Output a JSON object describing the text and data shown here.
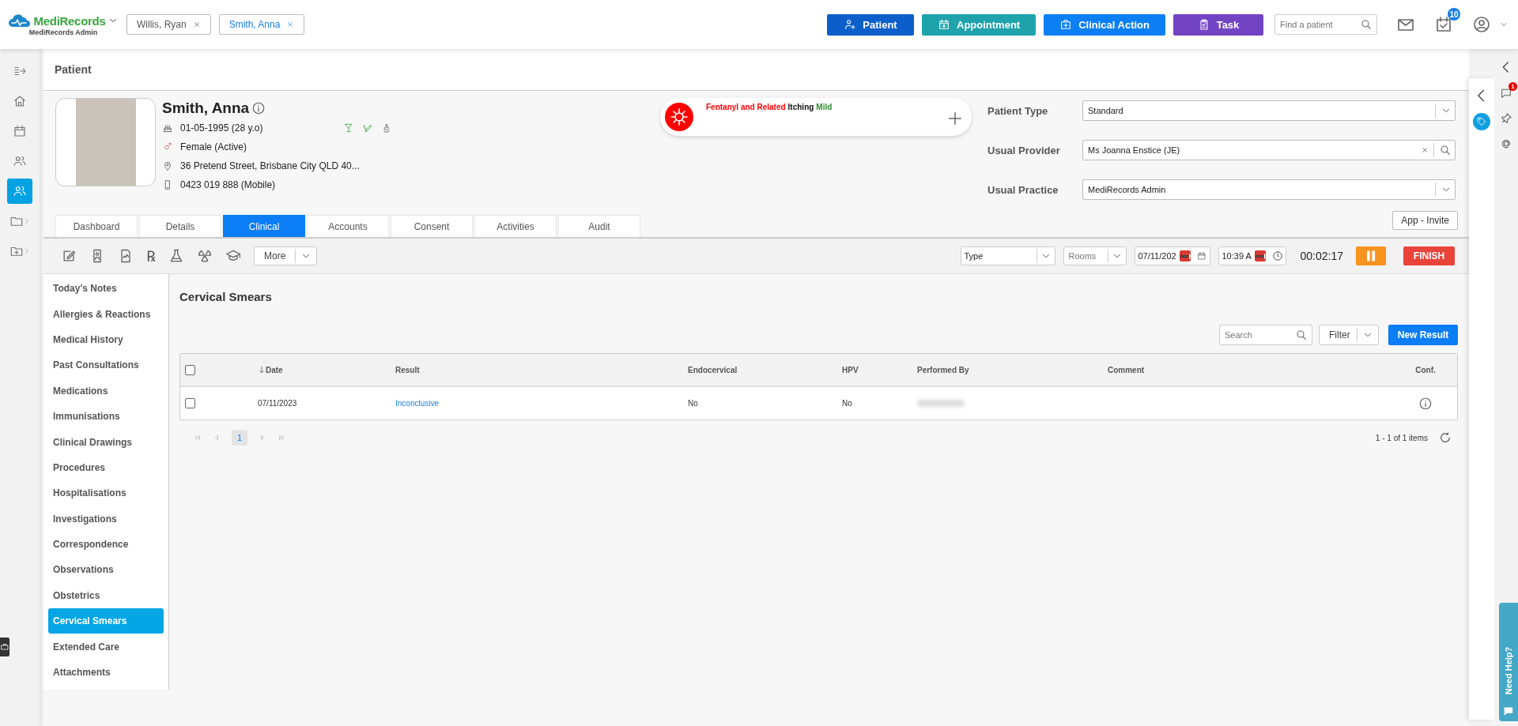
{
  "app": {
    "brand": "MediRecords",
    "subtitle": "MediRecords Admin"
  },
  "patient_tabs": [
    {
      "label": "Willis, Ryan",
      "selected": false
    },
    {
      "label": "Smith, Anna",
      "selected": true
    }
  ],
  "actions": [
    {
      "label": "Patient",
      "kind": "patient"
    },
    {
      "label": "Appointment",
      "kind": "appointment"
    },
    {
      "label": "Clinical Action",
      "kind": "clinical"
    },
    {
      "label": "Task",
      "kind": "task"
    }
  ],
  "find_patient": {
    "placeholder": "Find a patient"
  },
  "tasks_badge": "10",
  "rail": [
    {
      "kind": "collapse",
      "selected": false
    },
    {
      "kind": "home",
      "selected": false
    },
    {
      "kind": "calendar",
      "selected": false
    },
    {
      "kind": "group",
      "selected": false
    },
    {
      "kind": "patients",
      "selected": true
    },
    {
      "kind": "folder",
      "selected": false
    },
    {
      "kind": "folder-plus",
      "selected": false
    }
  ],
  "page_title": "Patient",
  "patient": {
    "name": "Smith, Anna",
    "dob": "01-05-1995 (28 y.o)",
    "gender": "Female (Active)",
    "address": "36 Pretend Street, Brisbane City QLD 40...",
    "phone": "0423 019 888 (Mobile)"
  },
  "allergy": {
    "substance": "Fentanyl and Related",
    "reaction": "Itching",
    "severity": "Mild"
  },
  "fields": [
    {
      "label": "Patient Type",
      "value": "Standard",
      "kind": "select"
    },
    {
      "label": "Usual Provider",
      "value": "Ms Joanna Enstice (JE)",
      "kind": "lookup"
    },
    {
      "label": "Usual Practice",
      "value": "MediRecords Admin",
      "kind": "select"
    }
  ],
  "app_invite": "App - Invite",
  "tabs": [
    {
      "label": "Dashboard",
      "selected": false
    },
    {
      "label": "Details",
      "selected": false
    },
    {
      "label": "Clinical",
      "selected": true
    },
    {
      "label": "Accounts",
      "selected": false
    },
    {
      "label": "Consent",
      "selected": false
    },
    {
      "label": "Activities",
      "selected": false
    },
    {
      "label": "Audit",
      "selected": false
    }
  ],
  "toolbar": {
    "tools": [
      {
        "kind": "edit"
      },
      {
        "kind": "id-doc"
      },
      {
        "kind": "chart-doc"
      },
      {
        "kind": "rx",
        "text": "℞"
      },
      {
        "kind": "flask"
      },
      {
        "kind": "radiation"
      },
      {
        "kind": "graduation"
      }
    ],
    "more": "More",
    "type": "Type",
    "rooms": {
      "placeholder": "Rooms"
    },
    "date": "07/11/202",
    "time": "10:39 A",
    "timer": "00:02:17",
    "finish": "FINISH"
  },
  "nav": [
    {
      "label": "Today's Notes",
      "selected": false
    },
    {
      "label": "Allergies & Reactions",
      "selected": false
    },
    {
      "label": "Medical History",
      "selected": false
    },
    {
      "label": "Past Consultations",
      "selected": false
    },
    {
      "label": "Medications",
      "selected": false
    },
    {
      "label": "Immunisations",
      "selected": false
    },
    {
      "label": "Clinical Drawings",
      "selected": false
    },
    {
      "label": "Procedures",
      "selected": false
    },
    {
      "label": "Hospitalisations",
      "selected": false
    },
    {
      "label": "Investigations",
      "selected": false
    },
    {
      "label": "Correspondence",
      "selected": false
    },
    {
      "label": "Observations",
      "selected": false
    },
    {
      "label": "Obstetrics",
      "selected": false
    },
    {
      "label": "Cervical Smears",
      "selected": true
    },
    {
      "label": "Extended Care",
      "selected": false
    },
    {
      "label": "Attachments",
      "selected": false
    }
  ],
  "section": {
    "title": "Cervical Smears",
    "search": {
      "placeholder": "Search"
    },
    "filter": "Filter",
    "new_button": "New Result"
  },
  "table": {
    "all_checked": false,
    "columns": [
      {
        "label": "Date",
        "sorted": true
      },
      {
        "label": "Result",
        "sorted": false
      },
      {
        "label": "Endocervical",
        "sorted": false
      },
      {
        "label": "HPV",
        "sorted": false
      },
      {
        "label": "Performed By",
        "sorted": false
      },
      {
        "label": "Comment",
        "sorted": false
      },
      {
        "label": "Conf.",
        "sorted": false
      }
    ],
    "rows": [
      {
        "checked": false,
        "date": "07/11/2023",
        "result": "Inconclusive",
        "endocervical": "No",
        "hpv": "No",
        "performed_by_blurred": true
      }
    ]
  },
  "pagination": {
    "pages": [
      {
        "label": "1",
        "selected": true
      }
    ],
    "summary": "1 - 1 of 1 items"
  },
  "chat_badge": "1",
  "help": "Need Help?"
}
